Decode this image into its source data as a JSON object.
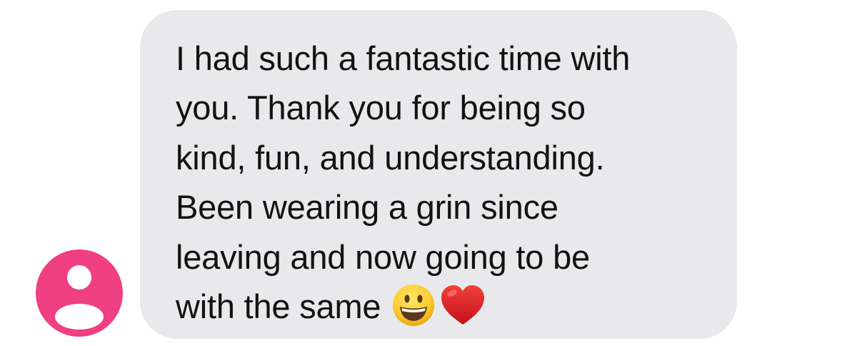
{
  "message": {
    "lines": [
      "I had such a fantastic time with",
      "you. Thank you for being so",
      "kind, fun, and understanding.",
      "Been wearing a grin since",
      "leaving and now going to be",
      "with the same"
    ],
    "emojis": [
      "grinning-face",
      "red-heart"
    ]
  },
  "avatar": {
    "icon": "person-icon",
    "color": "#f03f82"
  },
  "colors": {
    "bubble": "#e9e9eb",
    "text": "#121212"
  }
}
